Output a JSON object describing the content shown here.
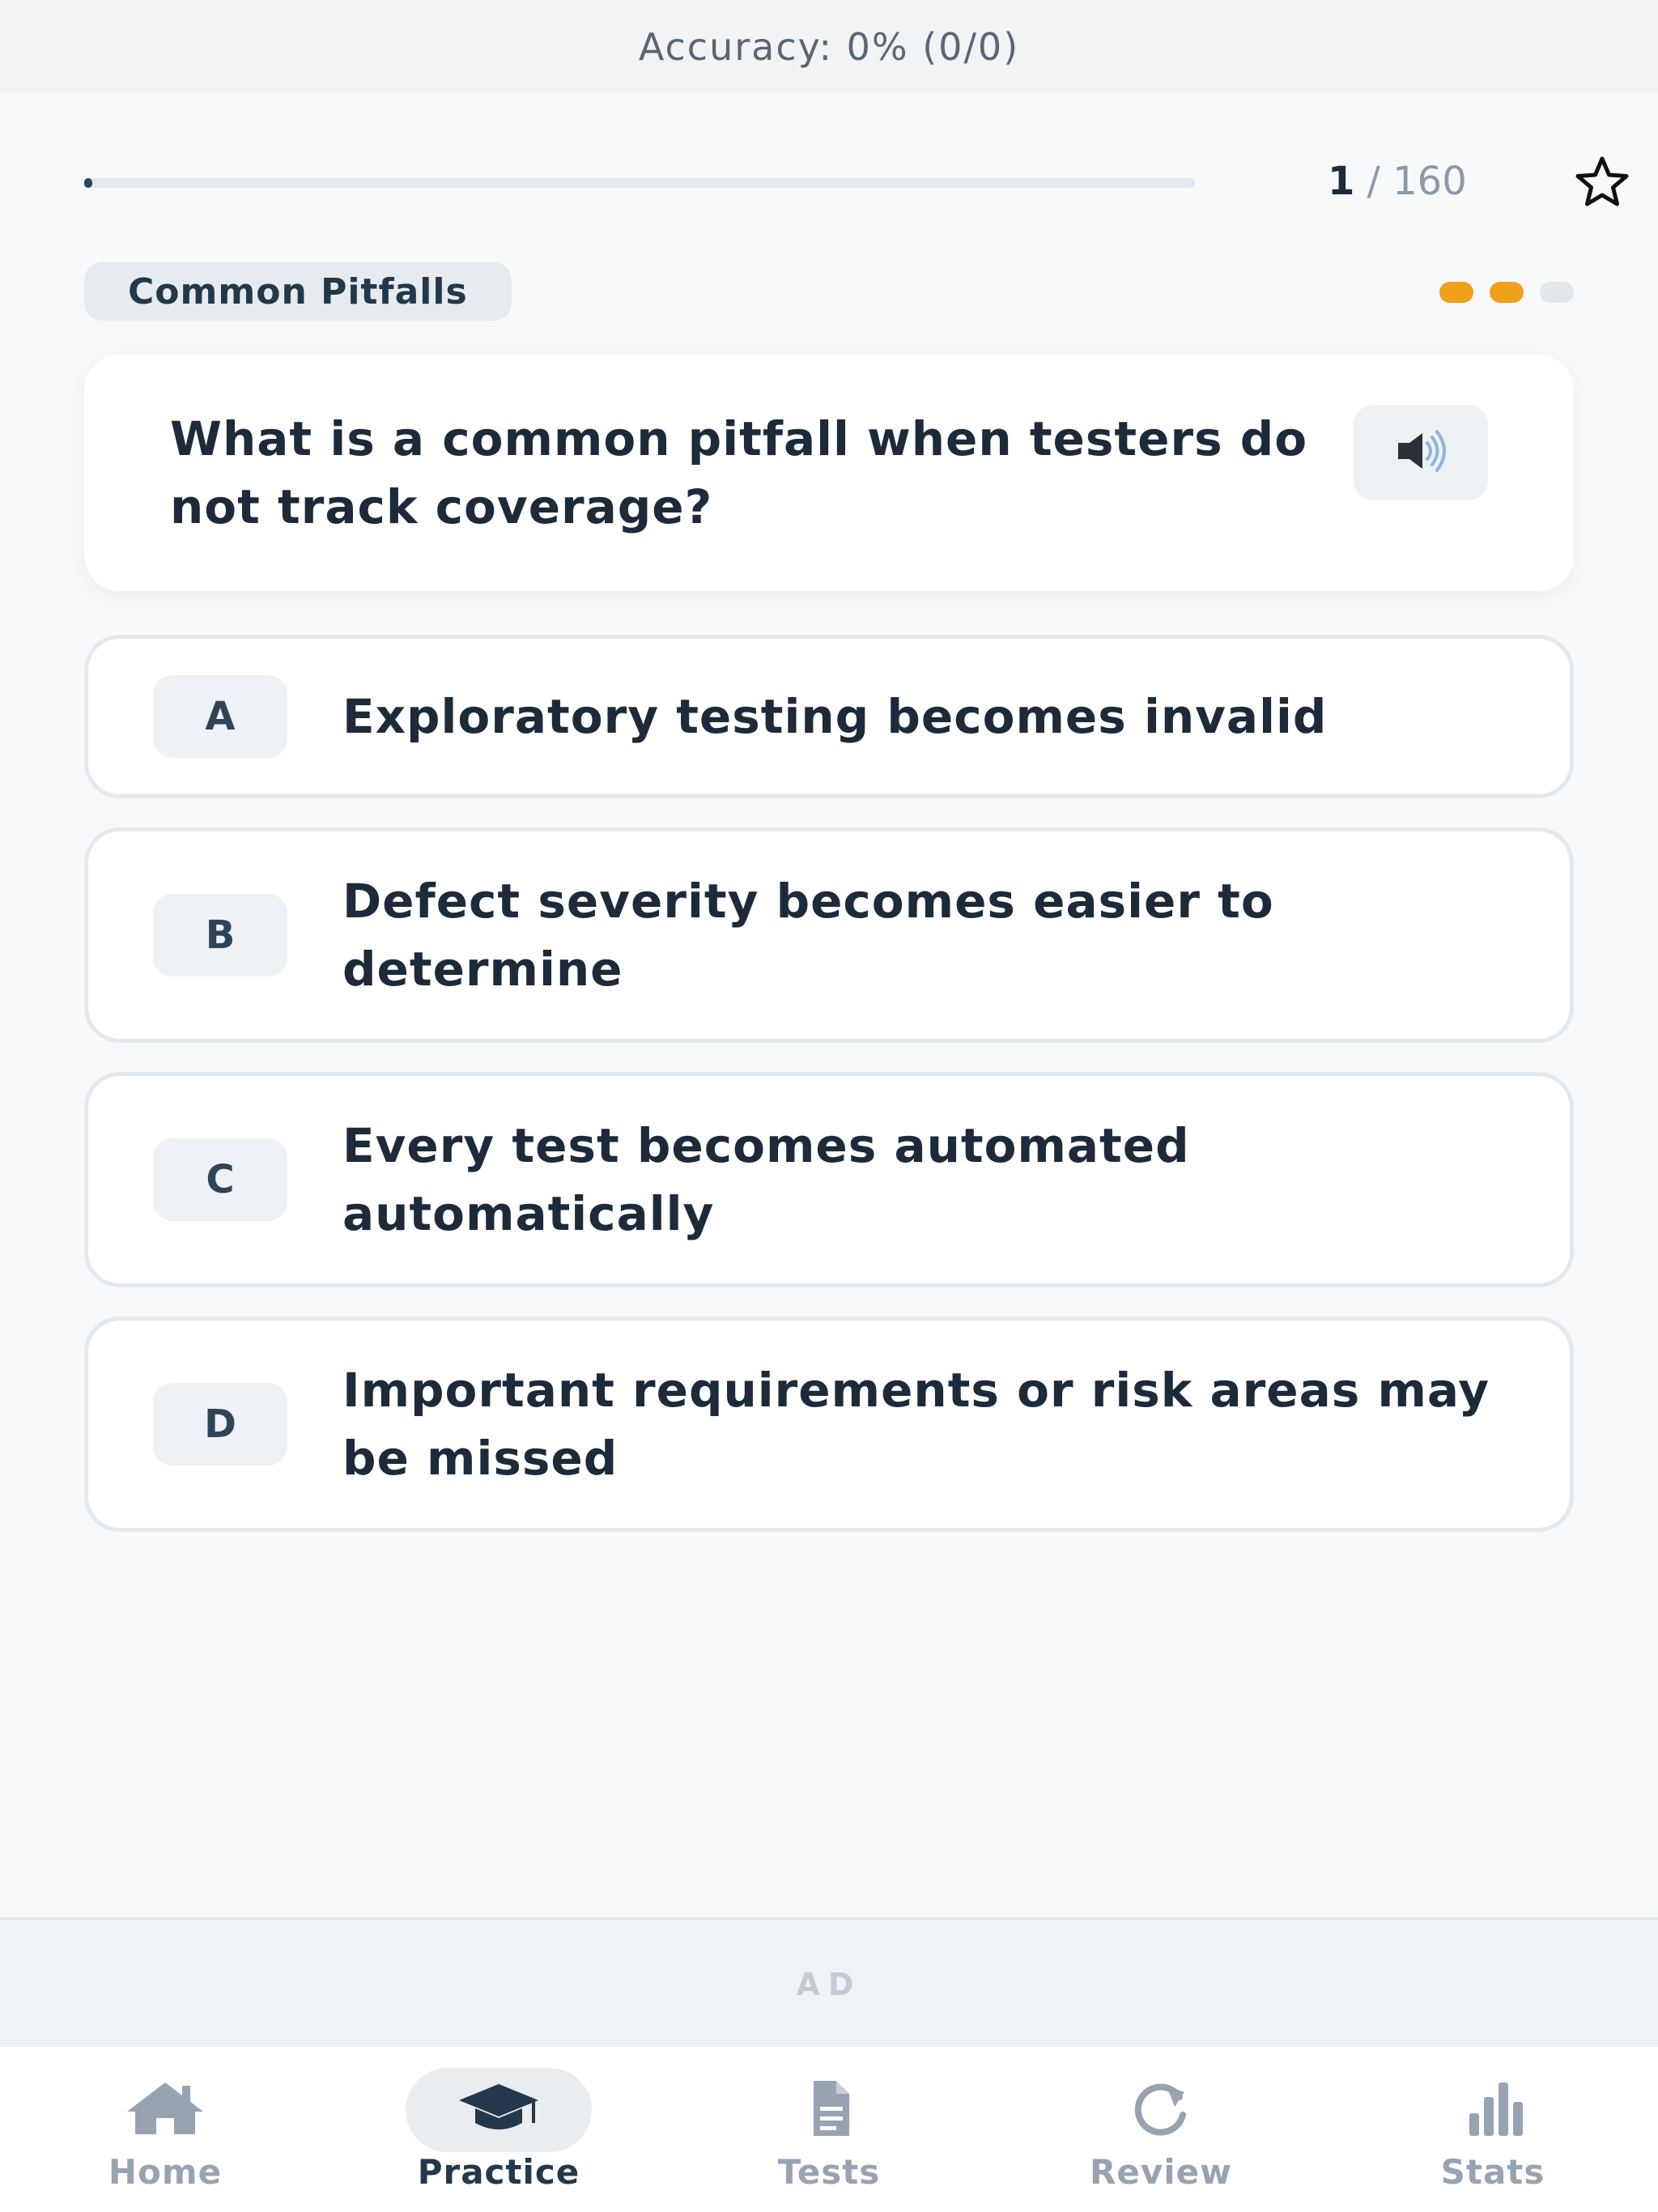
{
  "header": {
    "accuracy_text": "Accuracy: 0% (0/0)"
  },
  "progress": {
    "current": "1",
    "separator": "/",
    "total": "160",
    "fraction": 0.00625
  },
  "category": {
    "label": "Common Pitfalls",
    "difficulty_filled": 2,
    "difficulty_total": 3,
    "difficulty_color": "#f0a11a"
  },
  "question": {
    "text": "What is a common pitfall when testers do not track coverage?",
    "speaker_icon": "speaker-icon"
  },
  "options": [
    {
      "letter": "A",
      "text": "Exploratory testing becomes invalid"
    },
    {
      "letter": "B",
      "text": "Defect severity becomes easier to determine"
    },
    {
      "letter": "C",
      "text": "Every test becomes automated automatically"
    },
    {
      "letter": "D",
      "text": "Important requirements or risk areas may be missed"
    }
  ],
  "ad": {
    "label": "AD"
  },
  "tabs": [
    {
      "label": "Home",
      "icon": "home-icon",
      "active": false
    },
    {
      "label": "Practice",
      "icon": "graduation-cap-icon",
      "active": true
    },
    {
      "label": "Tests",
      "icon": "document-icon",
      "active": false
    },
    {
      "label": "Review",
      "icon": "refresh-icon",
      "active": false
    },
    {
      "label": "Stats",
      "icon": "bar-chart-icon",
      "active": false
    }
  ],
  "colors": {
    "accent": "#2f4456",
    "inactive_tab": "#98a3b2",
    "difficulty_on": "#f0a11a"
  }
}
